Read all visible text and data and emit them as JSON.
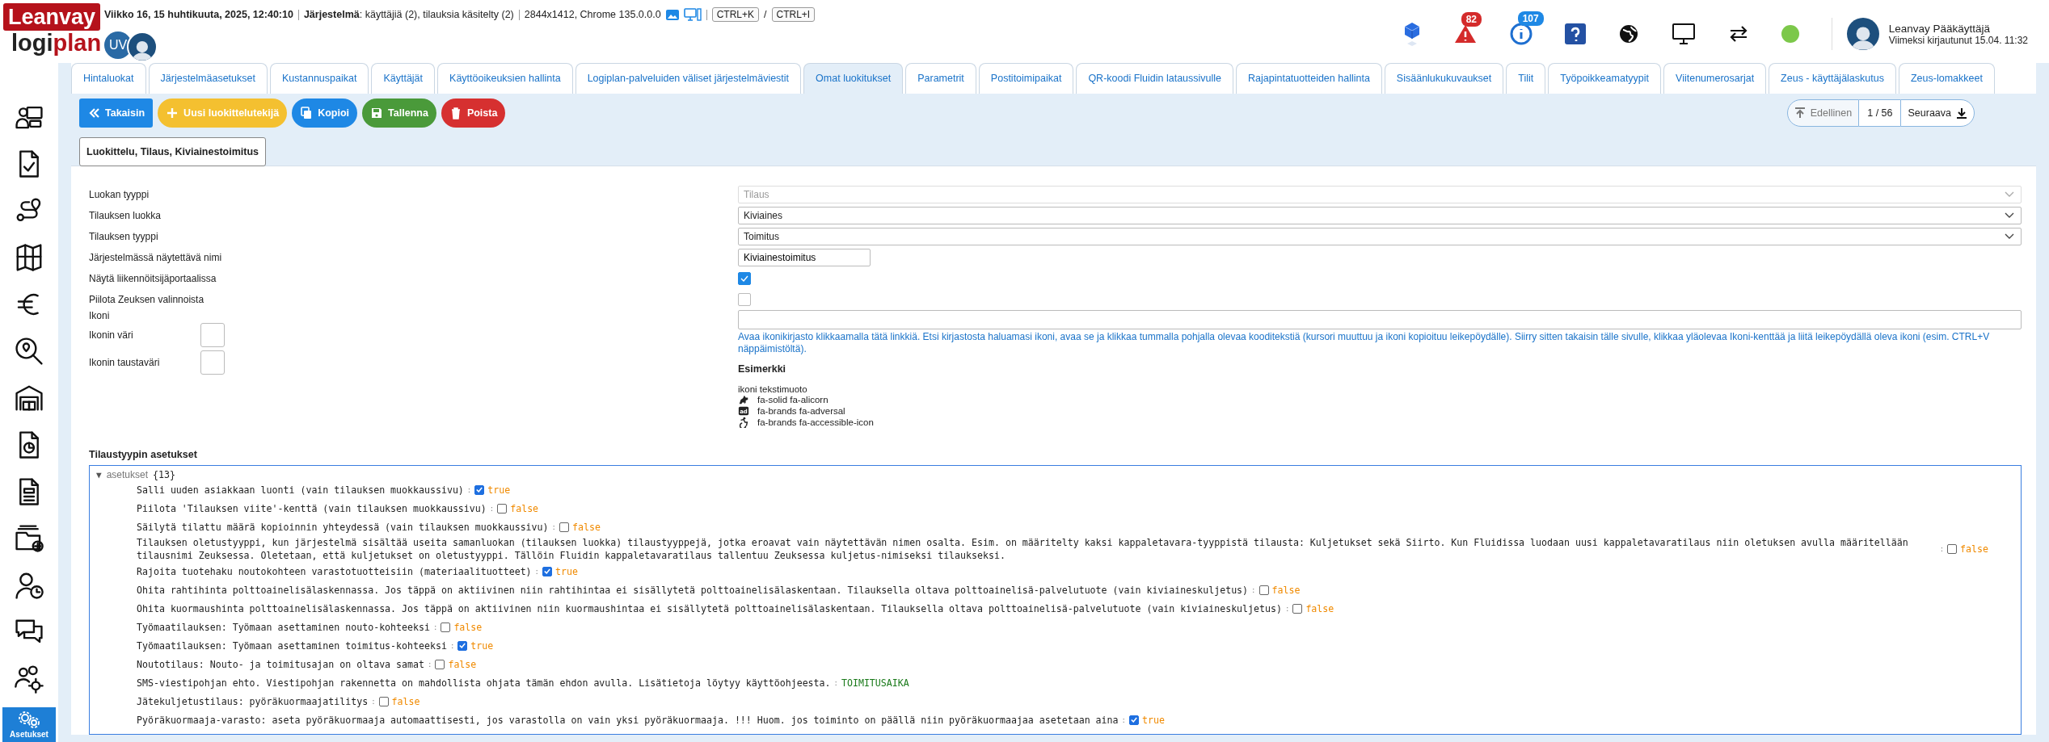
{
  "logo": {
    "brand": "Leanvay",
    "product": [
      "logi",
      "plan"
    ]
  },
  "header": {
    "datetime": "Viikko 16, 15 huhtikuuta, 2025, 12:40:10",
    "system": "**Järjestelmä**: käyttäjiä (2), tilauksia käsitelty (2)",
    "resolution": "2844x1412, Chrome 135.0.0.0",
    "shortcuts": [
      "CTRL+K",
      "CTRL+I"
    ],
    "shortcut_separator": "/",
    "user_initials": "UV"
  },
  "notifications": {
    "alerts": "82",
    "messages": "107"
  },
  "status": {
    "online": true
  },
  "user": {
    "name": "Leanvay Pääkäyttäjä",
    "last_login": "Viimeksi kirjautunut 15.04. 11:32"
  },
  "sidebar": [
    {
      "kind": "person-screen",
      "selected": false
    },
    {
      "kind": "document-check",
      "selected": false
    },
    {
      "kind": "route",
      "selected": false
    },
    {
      "kind": "map",
      "selected": false
    },
    {
      "kind": "euro",
      "selected": false
    },
    {
      "kind": "location-search",
      "selected": false
    },
    {
      "kind": "warehouse",
      "selected": false
    },
    {
      "kind": "document-chart",
      "selected": false
    },
    {
      "kind": "document",
      "selected": false
    },
    {
      "kind": "folder-plus",
      "selected": false
    },
    {
      "kind": "person-clock",
      "selected": false
    },
    {
      "kind": "chat",
      "selected": false
    },
    {
      "kind": "people-gear",
      "selected": false
    },
    {
      "kind": "gears",
      "label": "Asetukset",
      "selected": true
    }
  ],
  "tabs": [
    {
      "label": "Hintaluokat",
      "selected": false
    },
    {
      "label": "Järjestelmäasetukset",
      "selected": false
    },
    {
      "label": "Kustannuspaikat",
      "selected": false
    },
    {
      "label": "Käyttäjät",
      "selected": false
    },
    {
      "label": "Käyttöoikeuksien hallinta",
      "selected": false
    },
    {
      "label": "Logiplan-palveluiden väliset järjestelmäviestit",
      "selected": false
    },
    {
      "label": "Omat luokitukset",
      "selected": true
    },
    {
      "label": "Parametrit",
      "selected": false
    },
    {
      "label": "Postitoimipaikat",
      "selected": false
    },
    {
      "label": "QR-koodi Fluidin lataussivulle",
      "selected": false
    },
    {
      "label": "Rajapintatuotteiden hallinta",
      "selected": false
    },
    {
      "label": "Sisäänlukukuvaukset",
      "selected": false
    },
    {
      "label": "Tilit",
      "selected": false
    },
    {
      "label": "Työpoikkeamatyypit",
      "selected": false
    },
    {
      "label": "Viitenumerosarjat",
      "selected": false
    },
    {
      "label": "Zeus - käyttäjälaskutus",
      "selected": false
    },
    {
      "label": "Zeus-lomakkeet",
      "selected": false
    }
  ],
  "toolbar": {
    "buttons": [
      {
        "kind": "back",
        "label": "Takaisin"
      },
      {
        "kind": "new",
        "label": "Uusi luokittelutekijä"
      },
      {
        "kind": "copy",
        "label": "Kopioi"
      },
      {
        "kind": "save",
        "label": "Tallenna"
      },
      {
        "kind": "delete",
        "label": "Poista"
      }
    ],
    "pager": {
      "previous": "Edellinen",
      "previous_disabled": true,
      "position": "1 / 56",
      "next": "Seuraava"
    }
  },
  "form": {
    "title": "Luokittelu, Tilaus, Kiviainestoimitus",
    "fields": [
      {
        "label": "Luokan tyyppi",
        "kind": "select",
        "value": "Tilaus",
        "disabled": true
      },
      {
        "label": "Tilauksen luokka",
        "kind": "select",
        "value": "Kiviaines",
        "disabled": false
      },
      {
        "label": "Tilauksen tyyppi",
        "kind": "select",
        "value": "Toimitus",
        "disabled": false
      },
      {
        "label": "Järjestelmässä näytettävä nimi",
        "kind": "text",
        "value": "Kiviainestoimitus"
      },
      {
        "label": "Näytä liikennöitsijäportaalissa",
        "kind": "checkbox",
        "checked": true
      },
      {
        "label": "Piilota Zeuksen valinnoista",
        "kind": "checkbox",
        "checked": false
      }
    ],
    "icon_field": {
      "label": "Ikoni",
      "help_link": "Avaa ikonikirjasto klikkaamalla tätä linkkiä. Etsi kirjastosta haluamasi ikoni, avaa se ja klikkaa tummalla pohjalla olevaa kooditekstiä (kursori muuttuu ja ikoni kopioituu leikepöydälle). Siirry sitten takaisin tälle sivulle, klikkaa yläolevaa Ikoni-kenttää ja liitä leikepöydällä oleva ikoni (esim. CTRL+V näppäimistöltä).",
      "examples_title": "Esimerkki",
      "examples_heading": "ikoni tekstimuoto",
      "examples": [
        {
          "kind": "horse",
          "text": "fa-solid fa-alicorn"
        },
        {
          "kind": "ad",
          "text": "fa-brands fa-adversal"
        },
        {
          "kind": "wheelchair",
          "text": "fa-brands fa-accessible-icon"
        }
      ]
    },
    "color_fields": [
      {
        "label": "Ikonin väri"
      },
      {
        "label": "Ikonin taustaväri"
      }
    ]
  },
  "settings": {
    "title": "Tilaustyypin asetukset",
    "toggle": "▼",
    "expanded": true,
    "key": "asetukset",
    "count": "{13}",
    "separator": ":",
    "entries": [
      {
        "kind": "bool",
        "label": "Salli uuden asiakkaan luonti (vain tilauksen muokkaussivu)",
        "checked": true,
        "value": "true"
      },
      {
        "kind": "bool",
        "label": "Piilota 'Tilauksen viite'-kenttä (vain tilauksen muokkaussivu)",
        "checked": false,
        "value": "false"
      },
      {
        "kind": "bool",
        "label": "Säilytä tilattu määrä kopioinnin yhteydessä (vain tilauksen muokkaussivu)",
        "checked": false,
        "value": "false"
      },
      {
        "kind": "bool",
        "label": "Tilauksen oletustyyppi, kun järjestelmä sisältää useita samanluokan (tilauksen luokka) tilaustyyppejä, jotka eroavat vain näytettävän nimen osalta. Esim. on määritelty kaksi kappaletavara-tyyppistä tilausta: Kuljetukset sekä Siirto. Kun Fluidissa luodaan uusi kappaletavaratilaus niin oletuksen avulla määritellään tilausnimi Zeuksessa. Oletetaan, että kuljetukset on oletustyyppi. Tällöin Fluidin kappaletavaratilaus tallentuu Zeuksessa kuljetus-nimiseksi tilaukseksi.",
        "checked": false,
        "value": "false"
      },
      {
        "kind": "bool",
        "label": "Rajoita tuotehaku noutokohteen varastotuotteisiin (materiaalituotteet)",
        "checked": true,
        "value": "true"
      },
      {
        "kind": "bool",
        "label": "Ohita rahtihinta polttoainelisälaskennassa. Jos täppä on aktiivinen niin rahtihintaa ei sisällytetä polttoainelisälaskentaan. Tilauksella oltava polttoainelisä-palvelutuote (vain kiviaineskuljetus)",
        "checked": false,
        "value": "false"
      },
      {
        "kind": "bool",
        "label": "Ohita kuormaushinta polttoainelisälaskennassa. Jos täppä on aktiivinen niin kuormaushintaa ei sisällytetä polttoainelisälaskentaan. Tilauksella oltava polttoainelisä-palvelutuote (vain kiviaineskuljetus)",
        "checked": false,
        "value": "false"
      },
      {
        "kind": "bool",
        "label": "Työmaatilauksen: Työmaan asettaminen nouto-kohteeksi",
        "checked": false,
        "value": "false"
      },
      {
        "kind": "bool",
        "label": "Työmaatilauksen: Työmaan asettaminen toimitus-kohteeksi",
        "checked": true,
        "value": "true"
      },
      {
        "kind": "bool",
        "label": "Noutotilaus: Nouto- ja toimitusajan on oltava samat",
        "checked": false,
        "value": "false"
      },
      {
        "kind": "text",
        "label": "SMS-viestipohjan ehto. Viestipohjan rakennetta on mahdollista ohjata tämän ehdon avulla. Lisätietoja löytyy käyttöohjeesta.",
        "value": "TOIMITUSAIKA"
      },
      {
        "kind": "bool",
        "label": "Jätekuljetustilaus: pyöräkuormaajatilitys",
        "checked": false,
        "value": "false"
      },
      {
        "kind": "bool",
        "label": "Pyöräkuormaaja-varasto: aseta pyöräkuormaaja automaattisesti, jos varastolla on vain yksi pyöräkuormaaja. !!! Huom. jos toiminto on päällä niin pyöräkuormaajaa asetetaan aina",
        "checked": true,
        "value": "true"
      }
    ]
  }
}
